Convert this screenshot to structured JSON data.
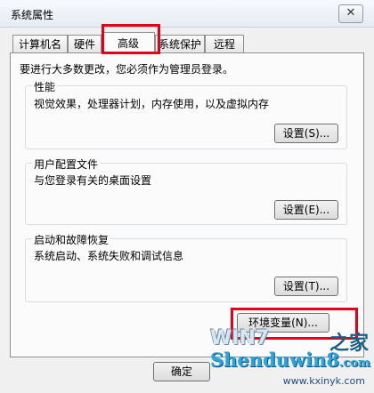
{
  "window": {
    "title": "系统属性",
    "close_glyph": "✕"
  },
  "tabs": [
    {
      "label": "计算机名"
    },
    {
      "label": "硬件"
    },
    {
      "label": "高级"
    },
    {
      "label": "系统保护"
    },
    {
      "label": "远程"
    }
  ],
  "active_tab": "高级",
  "intro": "要进行大多数更改，您必须作为管理员登录。",
  "groups": {
    "performance": {
      "title": "性能",
      "description": "视觉效果，处理器计划，内存使用，以及虚拟内存",
      "button": "设置(S)..."
    },
    "profiles": {
      "title": "用户配置文件",
      "description": "与您登录有关的桌面设置",
      "button": "设置(E)..."
    },
    "startup": {
      "title": "启动和故障恢复",
      "description": "系统启动、系统失败和调试信息",
      "button": "设置(T)..."
    }
  },
  "env_button": "环境变量(N)...",
  "footer": {
    "ok": "确定"
  },
  "watermark": {
    "logo": "WIN7",
    "logo_suffix": "之家",
    "main": "Shenduwin8",
    "main_suffix": ".com",
    "url": "www.kxinyk.com"
  },
  "colors": {
    "highlight": "#e3001b",
    "watermark_blue": "#2aa5e0"
  }
}
